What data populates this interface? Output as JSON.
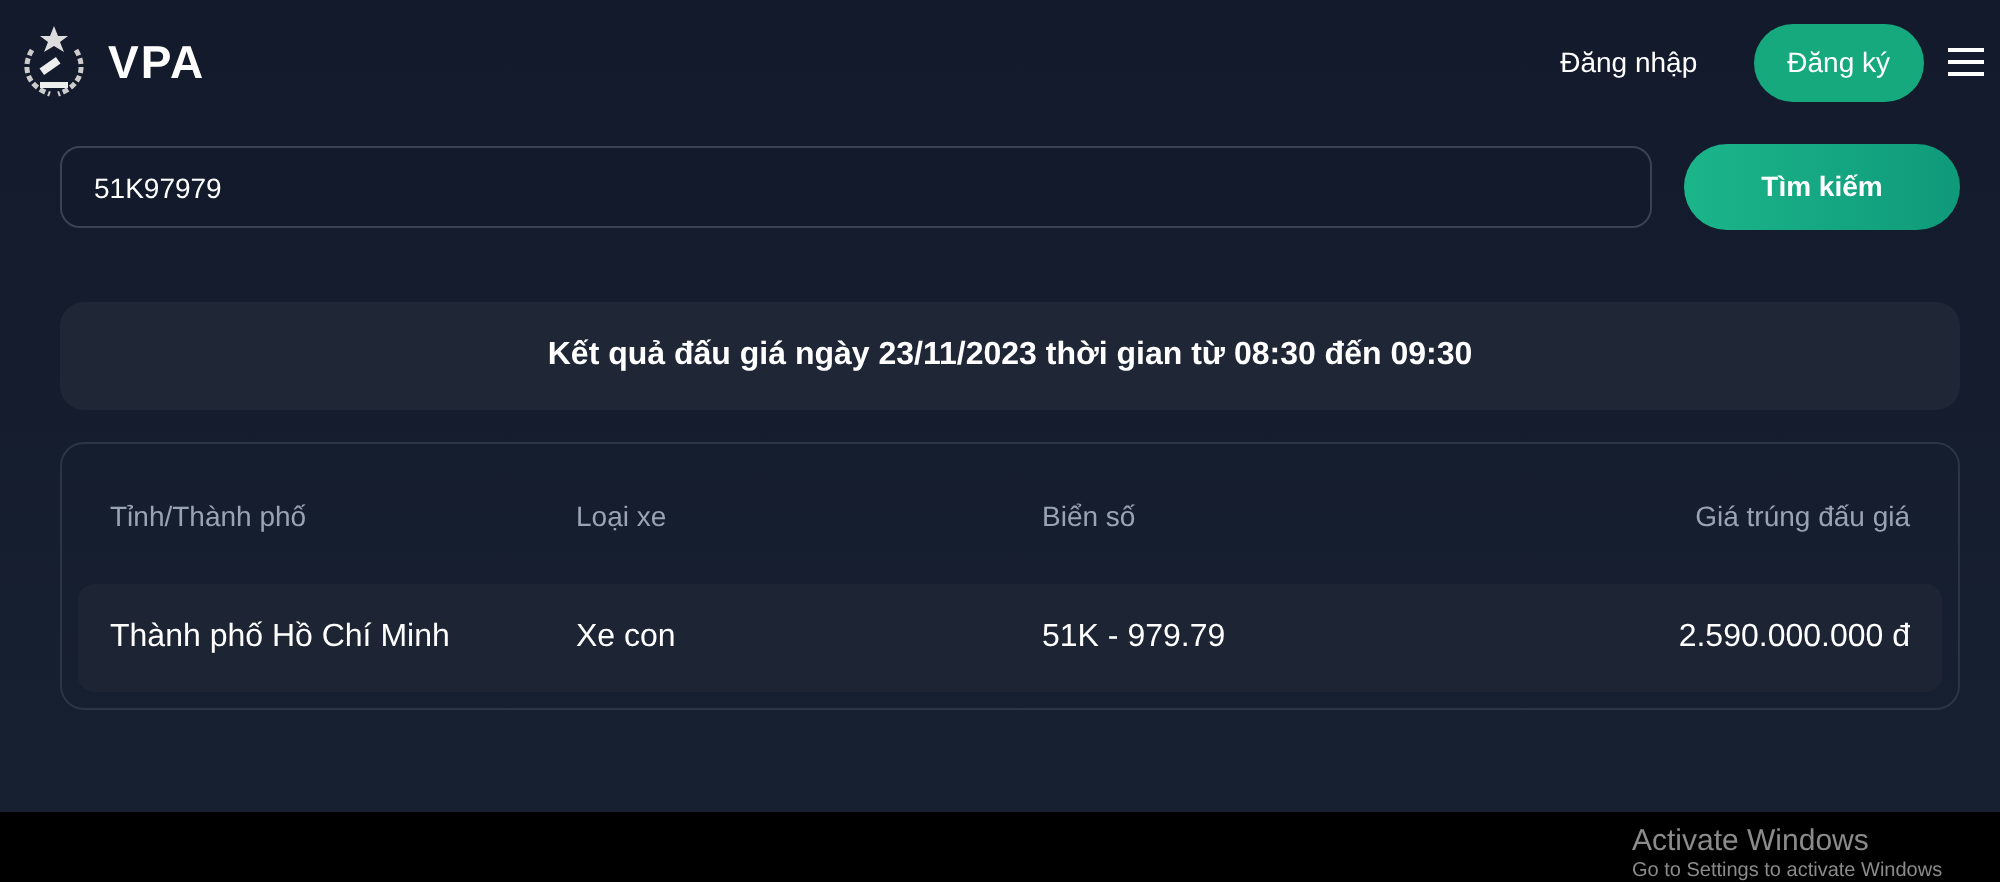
{
  "header": {
    "logo_text": "VPA",
    "nav": [
      {
        "label": "Đăng nhập",
        "kind": "link"
      },
      {
        "label": "Đăng ký",
        "kind": "button"
      }
    ]
  },
  "search": {
    "value": "51K97979",
    "button": "Tìm kiếm"
  },
  "result_title": "Kết quả đấu giá ngày 23/11/2023 thời gian từ 08:30 đến 09:30",
  "table": {
    "columns": [
      "Tỉnh/Thành phố",
      "Loại xe",
      "Biển số",
      "Giá trúng đấu giá"
    ],
    "rows": [
      [
        "Thành phố Hồ Chí Minh",
        "Xe con",
        "51K - 979.79",
        "2.590.000.000 đ"
      ]
    ]
  },
  "os_overlay": {
    "title": "Activate Windows",
    "subtitle": "Go to Settings to activate Windows"
  }
}
